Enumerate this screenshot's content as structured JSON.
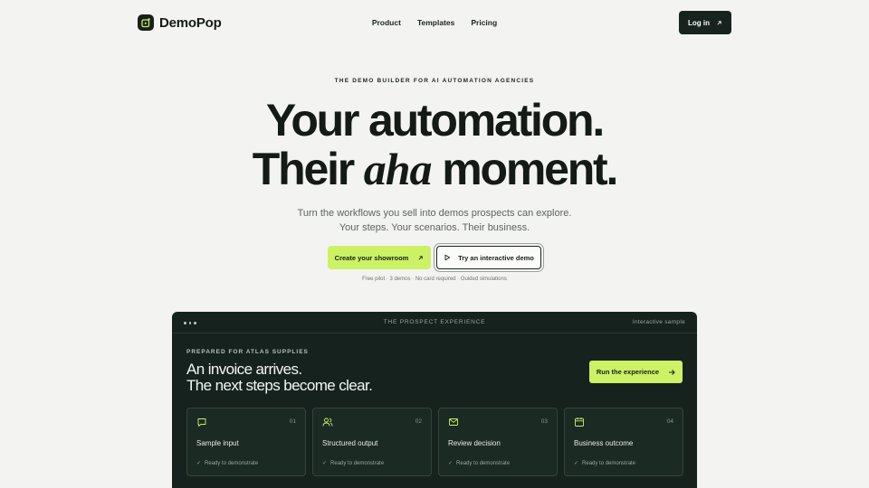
{
  "brand": {
    "name": "DemoPop",
    "logo_icon": "play-square-icon"
  },
  "nav": {
    "links": [
      "Product",
      "Templates",
      "Pricing"
    ],
    "login_label": "Log in"
  },
  "hero": {
    "eyebrow": "THE DEMO BUILDER FOR AI AUTOMATION AGENCIES",
    "headline_line1": "Your automation.",
    "headline_line2_pre": "Their ",
    "headline_line2_em": "aha",
    "headline_line2_post": " moment.",
    "sub_line1": "Turn the workflows you sell into demos prospects can explore.",
    "sub_line2": "Your steps. Your scenarios. Their business.",
    "primary_cta": "Create your showroom",
    "secondary_cta": "Try an interactive demo",
    "fineprint": "Free pilot · 3 demos · No card required · Guided simulations"
  },
  "panel": {
    "title": "THE PROSPECT EXPERIENCE",
    "tag": "Interactive sample",
    "prepared_for": "PREPARED FOR ATLAS SUPPLIES",
    "headline_line1": "An invoice arrives.",
    "headline_line2": "The next steps become clear.",
    "run_label": "Run the experience",
    "cards": [
      {
        "icon": "message-icon",
        "num": "01",
        "title": "Sample input",
        "status": "Ready to demonstrate"
      },
      {
        "icon": "users-icon",
        "num": "02",
        "title": "Structured output",
        "status": "Ready to demonstrate"
      },
      {
        "icon": "mail-icon",
        "num": "03",
        "title": "Review decision",
        "status": "Ready to demonstrate"
      },
      {
        "icon": "calendar-icon",
        "num": "04",
        "title": "Business outcome",
        "status": "Ready to demonstrate"
      }
    ]
  },
  "colors": {
    "accent": "#cdf165",
    "dark": "#16221d",
    "background": "#f3f4f2"
  }
}
